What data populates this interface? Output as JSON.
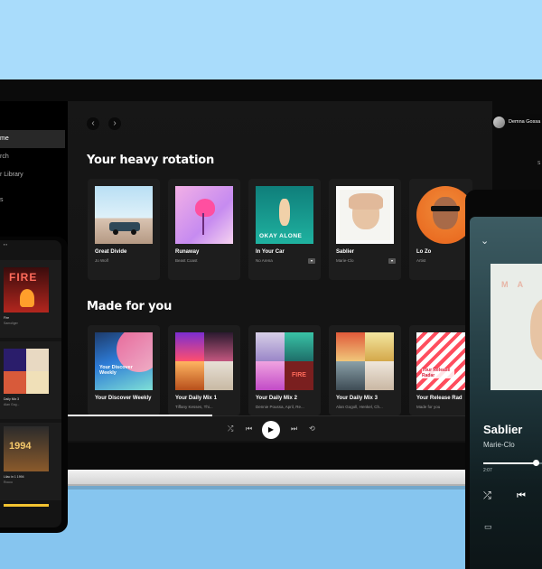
{
  "sidebar": {
    "items": [
      {
        "label": "me",
        "active": true
      },
      {
        "label": "rch",
        "active": false
      },
      {
        "label": "r Library",
        "active": false
      },
      {
        "label": "s",
        "active": false
      }
    ]
  },
  "header": {
    "back_icon": "‹",
    "forward_icon": "›",
    "user_name": "Demna Gossa"
  },
  "heavy_rotation": {
    "title": "Your heavy rotation",
    "see_all": "S",
    "items": [
      {
        "title": "Great Divide",
        "subtitle": "Jo Wolf"
      },
      {
        "title": "Runaway",
        "subtitle": "Beast Coast"
      },
      {
        "title": "In Your Car",
        "subtitle": "No Arena",
        "art_text": "OKAY ALONE"
      },
      {
        "title": "Sablier",
        "subtitle": "Marie-Clo"
      },
      {
        "title": "Lo Zo",
        "subtitle": "Artist"
      }
    ]
  },
  "made_for_you": {
    "title": "Made for you",
    "items": [
      {
        "title": "Your Discover Weekly",
        "subtitle": "",
        "art_text": "Your Discover Weekly"
      },
      {
        "title": "Your Daily Mix 1",
        "subtitle": "Tiffany Kesses, Thi..."
      },
      {
        "title": "Your Daily Mix 2",
        "subtitle": "Dennie Poussa, April, Re...",
        "art_text": "FIRE"
      },
      {
        "title": "Your Daily Mix 3",
        "subtitle": "Alan Gogoll, Henkel, Ch..."
      },
      {
        "title": "Your Release Rad",
        "subtitle": "Made for you",
        "art_text": "Your Release Radar"
      }
    ]
  },
  "player": {
    "shuffle_icon": "⤮",
    "prev_icon": "⏮",
    "play_icon": "▶",
    "next_icon": "⏭",
    "repeat_icon": "⟲"
  },
  "left_phone": {
    "status": "▪ ▪",
    "art_text_fire": "FIRE",
    "items": [
      {
        "caption": "Fire",
        "sub": "Samoliger"
      },
      {
        "caption": "Daily Mix 3",
        "sub": "Alan Gog..."
      },
      {
        "caption": "Lilac in 1 1994",
        "sub": "Rocco"
      }
    ],
    "art_text_year": "1994"
  },
  "right_phone": {
    "down_icon": "⌄",
    "title": "Sablier",
    "artist": "Marie-Clo",
    "time": "2:07",
    "progress": 0.85,
    "shuffle_icon": "⤮",
    "prev_icon": "⏮",
    "devices_icon": "▭"
  },
  "colors": {
    "background": "#a9dcfb",
    "app_bg": "#121212",
    "accent": "#ffffff"
  }
}
